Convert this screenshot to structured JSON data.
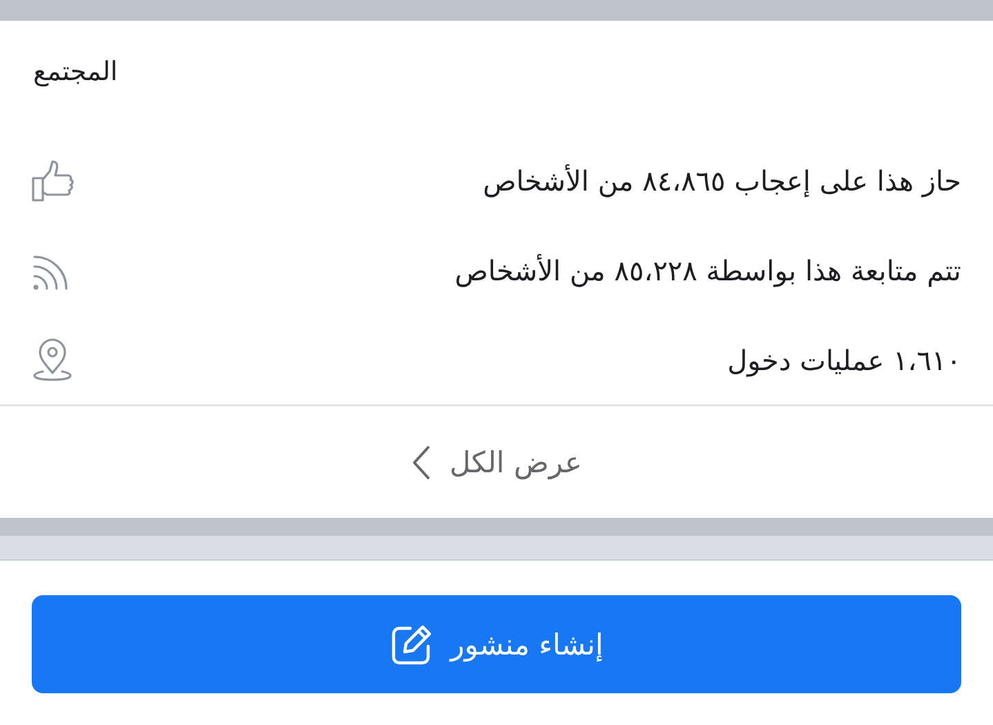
{
  "section": {
    "title": "المجتمع",
    "items": [
      {
        "kind": "like",
        "text": "حاز هذا على إعجاب ٨٤،٨٦٥ من الأشخاص"
      },
      {
        "kind": "follow",
        "text": "تتم متابعة هذا بواسطة ٨٥،٢٢٨ من الأشخاص"
      },
      {
        "kind": "checkin",
        "text": "١،٦١٠ عمليات دخول"
      }
    ],
    "see_all": "عرض الكل"
  },
  "create_post_button": "إنشاء منشور"
}
